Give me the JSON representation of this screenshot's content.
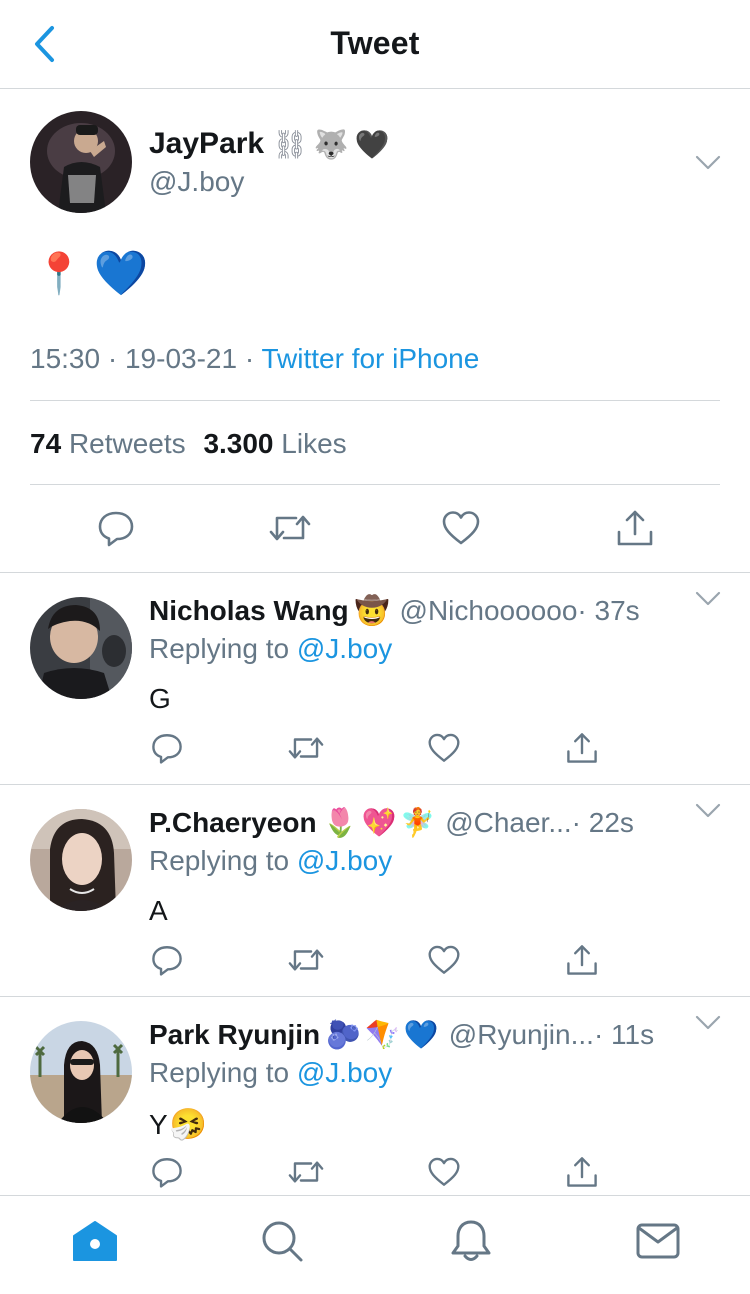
{
  "header": {
    "title": "Tweet"
  },
  "main_tweet": {
    "author_name": "JayPark",
    "author_emojis": [
      "⛓",
      "🐺",
      "🖤"
    ],
    "handle": "@J.boy",
    "body_emojis": [
      "📍",
      "💙"
    ],
    "time": "15:30",
    "date": "19-03-21",
    "source": "Twitter for iPhone",
    "separator": " · ",
    "retweets_count": "74",
    "retweets_label": "Retweets",
    "likes_count": "3.300",
    "likes_label": "Likes"
  },
  "replies": [
    {
      "name": "Nicholas Wang",
      "emojis": [
        "🤠"
      ],
      "handle": "@Nichoooooo",
      "time": " · 37s",
      "replying_label": "Replying to ",
      "mention": "@J.boy",
      "text": "G",
      "text_emoji": ""
    },
    {
      "name": "P.Chaeryeon",
      "emojis": [
        "🌷",
        "💖",
        "🧚"
      ],
      "handle": "@Chaer...",
      "time": " · 22s",
      "replying_label": "Replying to ",
      "mention": "@J.boy",
      "text": "A",
      "text_emoji": ""
    },
    {
      "name": "Park Ryunjin",
      "emojis": [
        "🫐",
        "🪁",
        "💙"
      ],
      "handle": "@Ryunjin...",
      "time": " · 11s",
      "replying_label": "Replying to ",
      "mention": "@J.boy",
      "text": "Y",
      "text_emoji": "🤧"
    }
  ],
  "tabbar": {
    "tabs": [
      "home-icon",
      "search-icon",
      "notifications-icon",
      "messages-icon"
    ],
    "active": "home-icon"
  },
  "colors": {
    "accent": "#1b95e0",
    "secondary_text": "#657786",
    "divider": "#d4d8db",
    "icon_gray": "#657786"
  }
}
